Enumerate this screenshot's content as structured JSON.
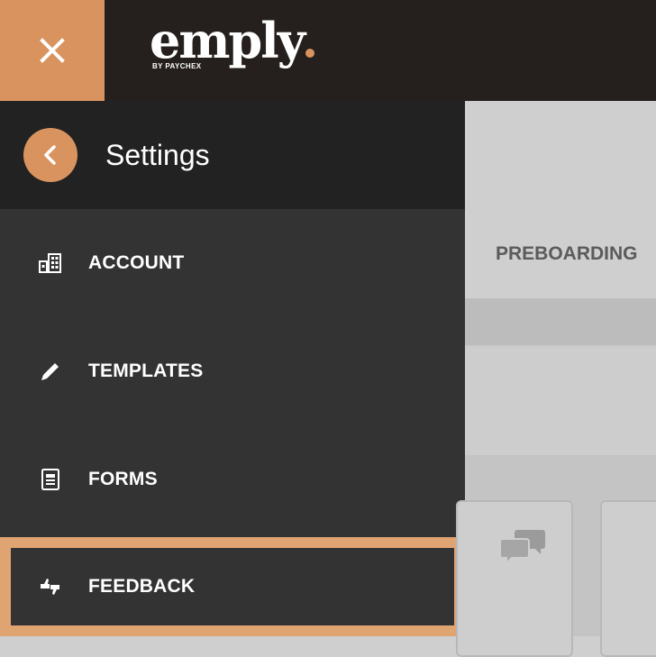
{
  "topbar": {
    "logo": {
      "word": "emply",
      "byline": "BY PAYCHEX"
    }
  },
  "sidebar": {
    "title": "Settings",
    "items": [
      {
        "label": "ACCOUNT",
        "icon": "building-icon",
        "active": false
      },
      {
        "label": "TEMPLATES",
        "icon": "pencil-icon",
        "active": false
      },
      {
        "label": "FORMS",
        "icon": "form-icon",
        "active": false
      },
      {
        "label": "FEEDBACK",
        "icon": "thumbs-icon",
        "active": true
      }
    ]
  },
  "background": {
    "tab_label": "PREBOARDING",
    "card_icon": "chat-bubbles-icon"
  },
  "colors": {
    "accent": "#d9935f",
    "topbar": "#25201d",
    "sidebar": "#333333",
    "sidebar_header": "#222222",
    "active_border": "#e0a473"
  }
}
